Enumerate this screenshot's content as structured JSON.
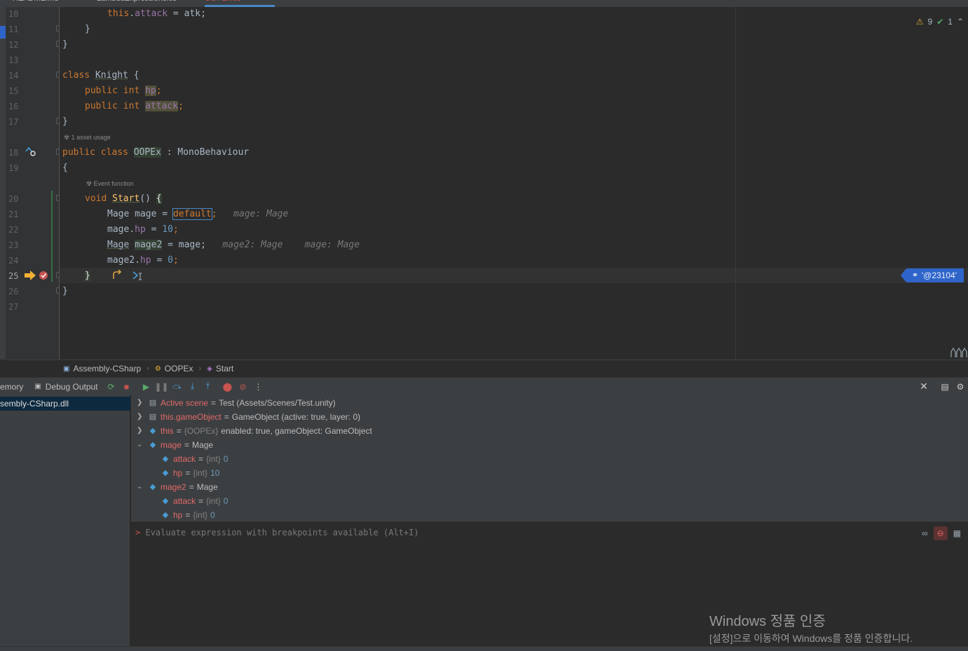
{
  "tabs": [
    {
      "label": "README.md"
    },
    {
      "label": "LambdaExpressions.cs"
    },
    {
      "label": "OOPEx.cs"
    }
  ],
  "gutter_lines": [
    "10",
    "11",
    "12",
    "13",
    "14",
    "15",
    "16",
    "17",
    "18",
    "19",
    "20",
    "21",
    "22",
    "23",
    "24",
    "25",
    "26",
    "27"
  ],
  "code": {
    "line10": {
      "a": "this",
      "b": ".",
      "c": "attack",
      "d": " = atk;"
    },
    "line11": "}",
    "line12": "}",
    "line14": {
      "kw": "class",
      "name": "Knight",
      "rest": " {"
    },
    "line15": {
      "kw1": "public",
      "kw2": "int",
      "field": "hp",
      "end": ";"
    },
    "line16": {
      "kw1": "public",
      "kw2": "int",
      "field": "attack",
      "end": ";"
    },
    "line17": "}",
    "asset_usage": "1 asset usage",
    "line18": {
      "kw1": "public",
      "kw2": "class",
      "name": "OOPEx",
      "rest": " : MonoBehaviour"
    },
    "line19": "{",
    "event_function": "Event function",
    "line20": {
      "kw": "void",
      "name": "Start",
      "rest": "() ",
      "brace": "{"
    },
    "line21": {
      "type": "Mage",
      "var": " mage = ",
      "val": "default",
      "end": ";",
      "hint": "mage: Mage"
    },
    "line22": {
      "obj": "mage",
      "dot": ".",
      "field": "hp",
      "op": " = ",
      "num": "10",
      "end": ";"
    },
    "line23": {
      "type": "Mage",
      "sp": " ",
      "var": "mage2",
      "rest": " = mage;",
      "hint1": "mage2: Mage",
      "hint2": "mage: Mage"
    },
    "line24": {
      "obj": "mage2",
      "dot": ".",
      "field": "hp",
      "op": " = ",
      "num": "0",
      "end": ";"
    },
    "line25": "}",
    "line26": "}"
  },
  "inspections": {
    "warnings": "9",
    "ok": "1"
  },
  "exec_badge": "'@23104'",
  "breadcrumb": [
    "Assembly-CSharp",
    "OOPEx",
    "Start"
  ],
  "debug_tabs": {
    "memory": "emory",
    "debug_output": "Debug Output"
  },
  "frames": {
    "selected": "sembly-CSharp.dll"
  },
  "variables": [
    {
      "name": "Active scene",
      "eq": " = ",
      "val": "Test (Assets/Scenes/Test.unity)"
    },
    {
      "name": "this.gameObject",
      "eq": " = ",
      "val": "GameObject (active: true, layer: 0)"
    },
    {
      "name": "this",
      "eq": " = ",
      "type": "{OOPEx}",
      "val": " enabled: true, gameObject: GameObject"
    },
    {
      "name": "mage",
      "eq": " = ",
      "val": "Mage"
    },
    {
      "name": "attack",
      "eq": " = ",
      "type": "{int}",
      "val": " 0"
    },
    {
      "name": "hp",
      "eq": " = ",
      "type": "{int}",
      "val": " 10"
    },
    {
      "name": "mage2",
      "eq": " = ",
      "val": "Mage"
    },
    {
      "name": "attack",
      "eq": " = ",
      "type": "{int}",
      "val": " 0"
    },
    {
      "name": "hp",
      "eq": " = ",
      "type": "{int}",
      "val": " 0"
    }
  ],
  "eval_placeholder": "Evaluate expression with breakpoints available (Alt+I)",
  "watermark": {
    "line1": "Windows 정품 인증",
    "line2": "[설정]으로 이동하여 Windows를 정품 인증합니다."
  },
  "colors": {
    "accent": "#2f65ca",
    "error": "#c75450",
    "success": "#59a869",
    "warning": "#e0b030"
  }
}
